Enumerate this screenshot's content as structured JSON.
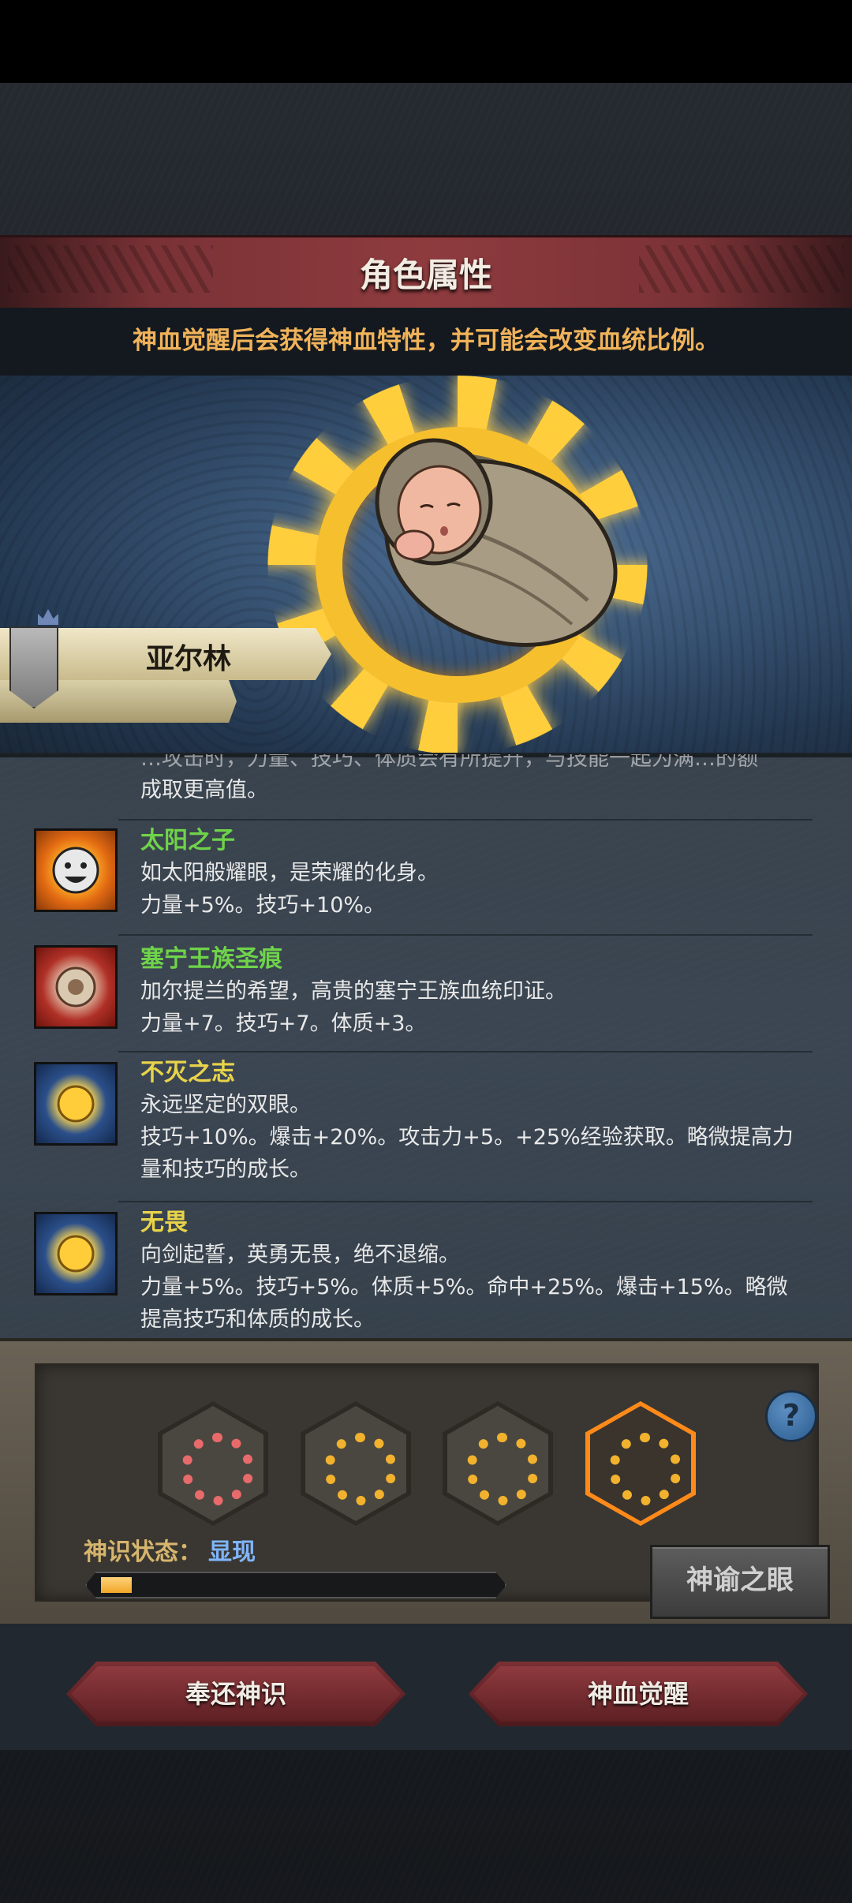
{
  "screen": {
    "title": "角色属性",
    "hint": "神血觉醒后会获得神血特性，并可能会改变血统比例。"
  },
  "character": {
    "name": "亚尔林"
  },
  "traits_cutoff": {
    "line1": "…攻击时，力量、技巧、体质会有所提升，与技能一起为满…的额",
    "line2": "成取更高值。"
  },
  "traits": [
    {
      "name": "太阳之子",
      "name_color": "#6fd34a",
      "icon": "smiling-sun-icon",
      "desc": "如太阳般耀眼，是荣耀的化身。\n力量+5%。技巧+10%。"
    },
    {
      "name": "塞宁王族圣痕",
      "name_color": "#6fd34a",
      "icon": "royal-crest-icon",
      "desc": "加尔提兰的希望，高贵的塞宁王族血统印证。\n力量+7。技巧+7。体质+3。"
    },
    {
      "name": "不灭之志",
      "name_color": "#e8d34a",
      "icon": "golden-sun-icon",
      "desc": "永远坚定的双眼。\n技巧+10%。爆击+20%。攻击力+5。+25%经验获取。略微提高力量和技巧的成长。"
    },
    {
      "name": "无畏",
      "name_color": "#e8d34a",
      "icon": "golden-sun-icon",
      "desc": "向剑起誓，英勇无畏，绝不退缩。\n力量+5%。技巧+5%。体质+5%。命中+25%。爆击+15%。略微提高技巧和体质的成长。"
    }
  ],
  "awakening": {
    "slots": [
      {
        "icon": "red-sun-rune-icon",
        "color": "#e86a6a",
        "active": false
      },
      {
        "icon": "gold-sun-rune-icon",
        "color": "#f2b22e",
        "active": false
      },
      {
        "icon": "gold-sun-rune-icon",
        "color": "#f2b22e",
        "active": false
      },
      {
        "icon": "gold-sun-rune-icon",
        "color": "#f2b22e",
        "active": true
      }
    ],
    "status_label": "神识状态：",
    "status_value": "显现",
    "progress": 0.08,
    "eye_button": "神谕之眼"
  },
  "buttons": {
    "return": "奉还神识",
    "awaken": "神血觉醒"
  }
}
